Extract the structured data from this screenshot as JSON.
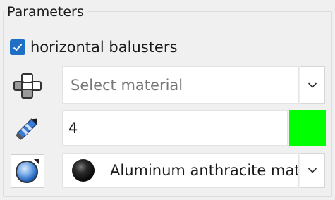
{
  "panel": {
    "title": "Parameters"
  },
  "checkbox": {
    "label": "horizontal balusters",
    "checked": true
  },
  "rows": {
    "material": {
      "icon": "baluster-profile-icon",
      "placeholder": "Select material"
    },
    "value": {
      "icon": "pencil-icon",
      "value": "4",
      "color": "#00ff00"
    },
    "texture": {
      "icon": "material-sphere-icon",
      "selected": "Aluminum anthracite mat"
    }
  },
  "colors": {
    "accent": "#1f6fc5",
    "swatch": "#00ff00"
  }
}
